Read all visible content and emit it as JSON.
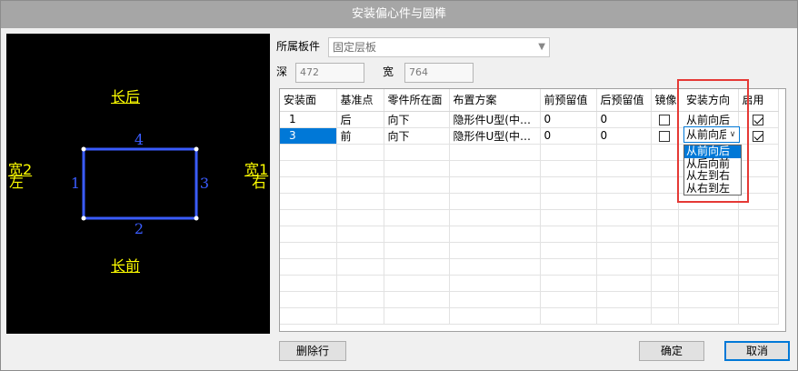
{
  "window": {
    "title": "安装偏心件与圆榫"
  },
  "preview": {
    "top_label": "长后",
    "bottom_label": "长前",
    "left_label_1": "宽2",
    "left_label_2": "左",
    "right_label_1": "宽1",
    "right_label_2": "右",
    "edge_top": "4",
    "edge_bottom": "2",
    "edge_left": "1",
    "edge_right": "3",
    "colors": {
      "background": "#000000",
      "label": "#ffff00",
      "rect": "#3a5cff",
      "edge_number": "#3a5cff"
    }
  },
  "form": {
    "panel_label": "所属板件",
    "panel_value": "固定层板",
    "depth_label": "深",
    "depth_value": "472",
    "width_label": "宽",
    "width_value": "764"
  },
  "table": {
    "headers": [
      "安装面",
      "基准点",
      "零件所在面",
      "布置方案",
      "前预留值",
      "后预留值",
      "镜像",
      "安装方向",
      "启用"
    ],
    "rows": [
      {
        "face": "1",
        "base": "后",
        "part_face": "向下",
        "plan": "隐形件U型(中…",
        "front": "0",
        "back": "0",
        "mirror": false,
        "direction": "从前向后",
        "enabled": true
      },
      {
        "face": "3",
        "base": "前",
        "part_face": "向下",
        "plan": "隐形件U型(中…",
        "front": "0",
        "back": "0",
        "mirror": false,
        "direction": "从前向后",
        "enabled": true
      }
    ]
  },
  "direction_combo": {
    "value": "从前向后",
    "options": [
      "从前向后",
      "从后向前",
      "从左到右",
      "从右到左"
    ]
  },
  "buttons": {
    "delete": "删除行",
    "ok": "确定",
    "cancel": "取消"
  },
  "accent": "#0078d7",
  "highlight_box_color": "#e53935"
}
